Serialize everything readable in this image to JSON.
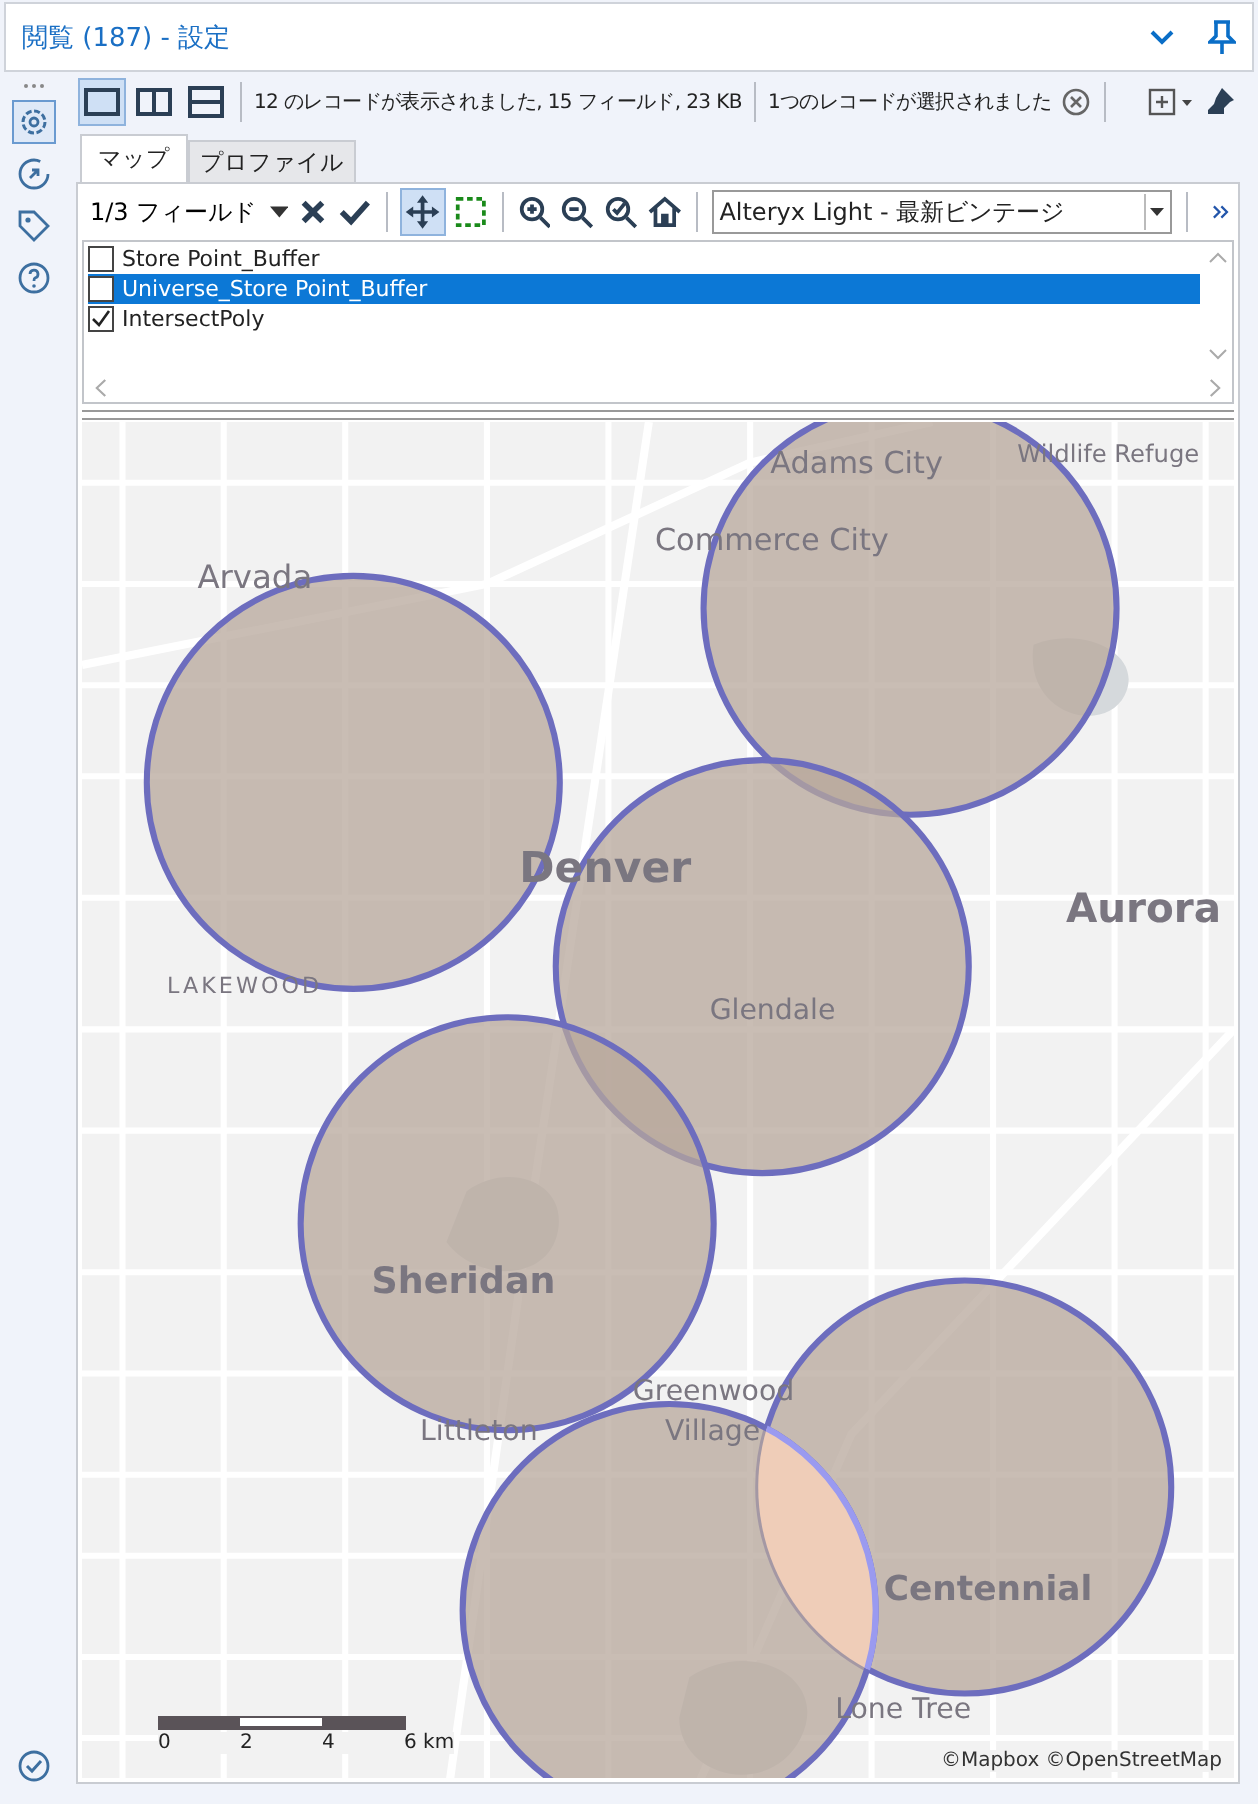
{
  "window": {
    "title": "閲覧 (187) - 設定"
  },
  "status": {
    "records": "12 のレコードが表示されました, 15 フィールド, 23 KB",
    "selection": "1つのレコードが選択されました"
  },
  "tabs": [
    {
      "label": "マップ",
      "selected": true
    },
    {
      "label": "プロファイル",
      "selected": false
    }
  ],
  "map_toolbar": {
    "field_selector": "1/3 フィールド",
    "basemap": "Alteryx Light - 最新ビンテージ"
  },
  "layers": [
    {
      "label": "Store Point_Buffer",
      "checked": false,
      "selected": false
    },
    {
      "label": "Universe_Store Point_Buffer",
      "checked": false,
      "selected": true
    },
    {
      "label": "IntersectPoly",
      "checked": true,
      "selected": false
    }
  ],
  "map": {
    "labels": [
      "Adams City",
      "Wildlife Refuge",
      "Commerce City",
      "Arvada",
      "Denver",
      "Aurora",
      "LAKEWOOD",
      "Glendale",
      "Sheridan",
      "Greenwood",
      "Littleton",
      "Village",
      "Centennial",
      "Lone Tree"
    ],
    "scale_labels": [
      "0",
      "2",
      "4",
      "6 km"
    ],
    "attribution": "©Mapbox ©OpenStreetMap"
  }
}
